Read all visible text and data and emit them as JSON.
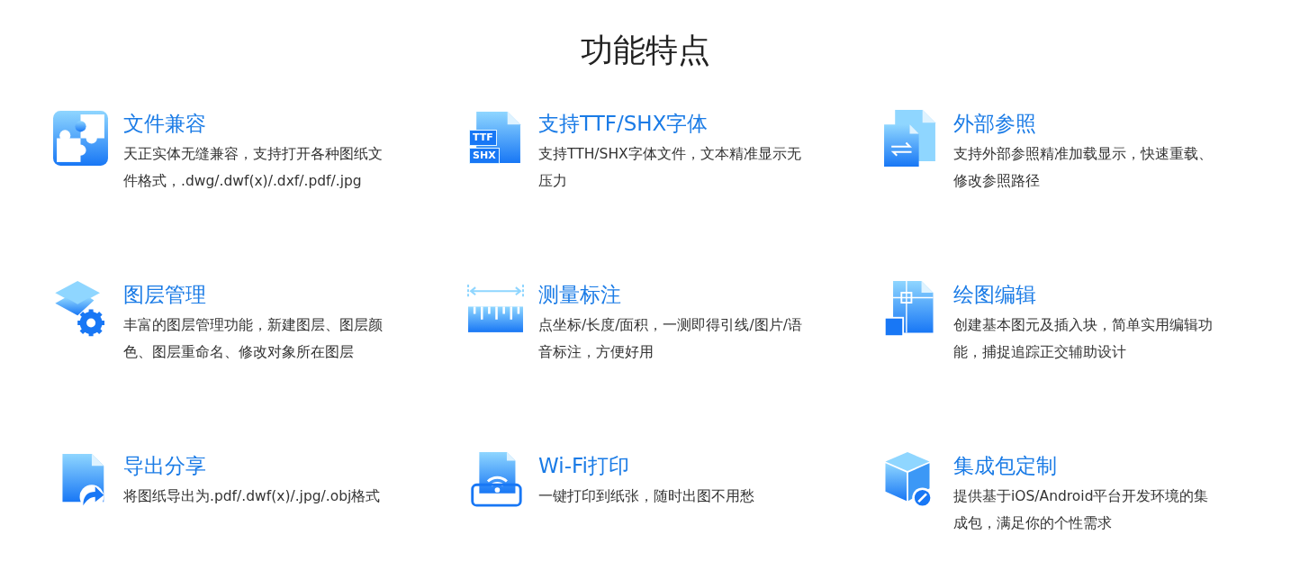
{
  "heading": "功能特点",
  "features": [
    {
      "title": "文件兼容",
      "description": "天正实体无缝兼容，支持打开各种图纸文件格式，.dwg/.dwf(x)/.dxf/.pdf/.jpg"
    },
    {
      "title": "支持TTF/SHX字体",
      "description": "支持TTH/SHX字体文件，文本精准显示无压力",
      "badges": [
        "TTF",
        "SHX"
      ]
    },
    {
      "title": "外部参照",
      "description": "支持外部参照精准加载显示，快速重载、修改参照路径"
    },
    {
      "title": "图层管理",
      "description": "丰富的图层管理功能，新建图层、图层颜色、图层重命名、修改对象所在图层"
    },
    {
      "title": "测量标注",
      "description": "点坐标/长度/面积，一测即得引线/图片/语音标注，方便好用"
    },
    {
      "title": "绘图编辑",
      "description": "创建基本图元及插入块，简单实用编辑功能，捕捉追踪正交辅助设计"
    },
    {
      "title": "导出分享",
      "description": "将图纸导出为.pdf/.dwf(x)/.jpg/.obj格式"
    },
    {
      "title": "Wi-Fi打印",
      "description": "一键打印到纸张，随时出图不用愁"
    },
    {
      "title": "集成包定制",
      "description": "提供基于iOS/Android平台开发环境的集成包，满足你的个性需求"
    }
  ]
}
